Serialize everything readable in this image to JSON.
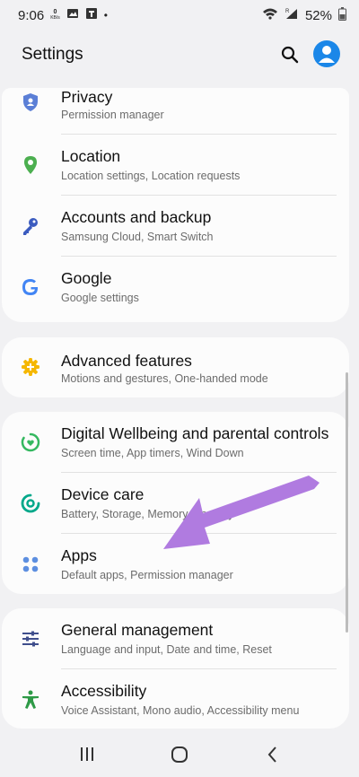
{
  "status": {
    "time": "9:06",
    "kbs_value": "0",
    "kbs_unit": "KB/s",
    "dot": "•",
    "battery": "52%"
  },
  "header": {
    "title": "Settings"
  },
  "cards": [
    {
      "items": [
        {
          "title": "Privacy",
          "subtitle": "Permission manager"
        },
        {
          "title": "Location",
          "subtitle": "Location settings, Location requests"
        },
        {
          "title": "Accounts and backup",
          "subtitle": "Samsung Cloud, Smart Switch"
        },
        {
          "title": "Google",
          "subtitle": "Google settings"
        }
      ]
    },
    {
      "items": [
        {
          "title": "Advanced features",
          "subtitle": "Motions and gestures, One-handed mode"
        }
      ]
    },
    {
      "items": [
        {
          "title": "Digital Wellbeing and parental controls",
          "subtitle": "Screen time, App timers, Wind Down"
        },
        {
          "title": "Device care",
          "subtitle": "Battery, Storage, Memory, Security"
        },
        {
          "title": "Apps",
          "subtitle": "Default apps, Permission manager"
        }
      ]
    },
    {
      "items": [
        {
          "title": "General management",
          "subtitle": "Language and input, Date and time, Reset"
        },
        {
          "title": "Accessibility",
          "subtitle": "Voice Assistant, Mono audio, Accessibility menu"
        }
      ]
    }
  ],
  "icons": {
    "privacy": "privacy-shield-icon",
    "location": "location-pin-icon",
    "accounts": "key-icon",
    "google": "google-g-icon",
    "advanced": "advanced-features-gear-icon",
    "wellbeing": "digital-wellbeing-icon",
    "device_care": "device-care-icon",
    "apps": "apps-grid-icon",
    "general": "sliders-icon",
    "accessibility": "accessibility-person-icon"
  },
  "colors": {
    "privacy": "#5b7fd6",
    "location": "#4caf50",
    "accounts": "#3b5bbf",
    "google": "#4285f4",
    "advanced": "#f5b700",
    "wellbeing": "#35b860",
    "device_care": "#00a88a",
    "apps": "#5d8fe0",
    "general": "#3f4e8c",
    "accessibility": "#2e9a47",
    "arrow": "#b07be0",
    "avatar": "#1b87e8"
  }
}
